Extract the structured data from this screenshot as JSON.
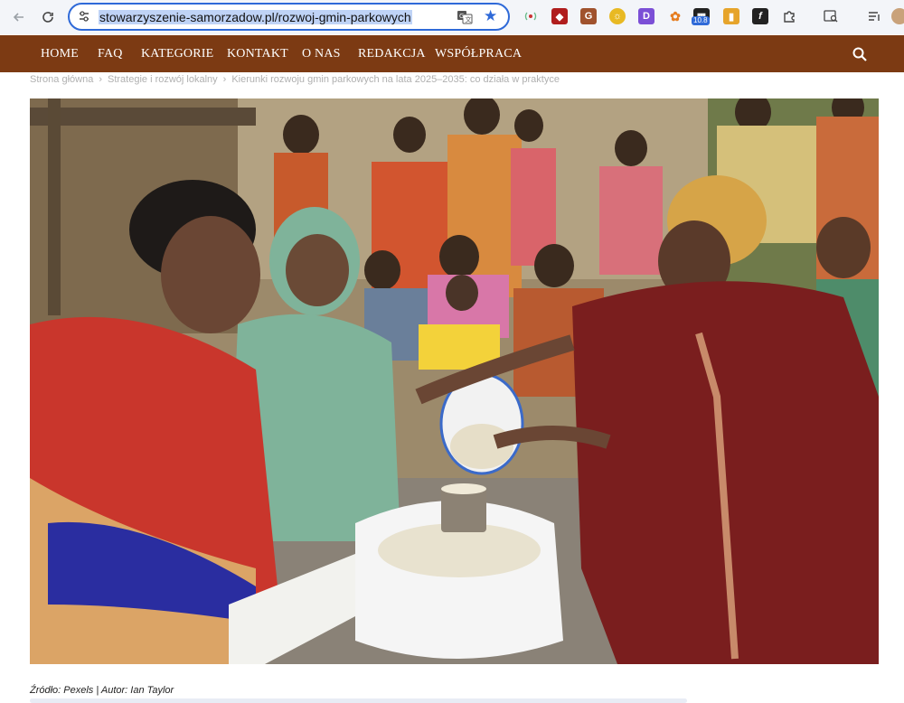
{
  "browser": {
    "url": "stowarzyszenie-samorzadow.pl/rozwoj-gmin-parkowych",
    "extension_badge": "10.8"
  },
  "nav": {
    "items": [
      {
        "label": "HOME"
      },
      {
        "label": "FAQ"
      },
      {
        "label": "KATEGORIE"
      },
      {
        "label": "KONTAKT"
      },
      {
        "label": "O NAS"
      },
      {
        "label": "REDAKCJA"
      },
      {
        "label": "WSPÓŁPRACA"
      }
    ]
  },
  "breadcrumb": {
    "home": "Strona główna",
    "category": "Strategie i rozwój lokalny",
    "current": "Kierunki rozwoju gmin parkowych na lata 2025–2035: co działa w praktyce",
    "separator": "›"
  },
  "image": {
    "caption": "Źródło: Pexels | Autor: Ian Taylor"
  },
  "colors": {
    "nav_bg": "#7c3a13",
    "accent": "#2f6ad8"
  }
}
